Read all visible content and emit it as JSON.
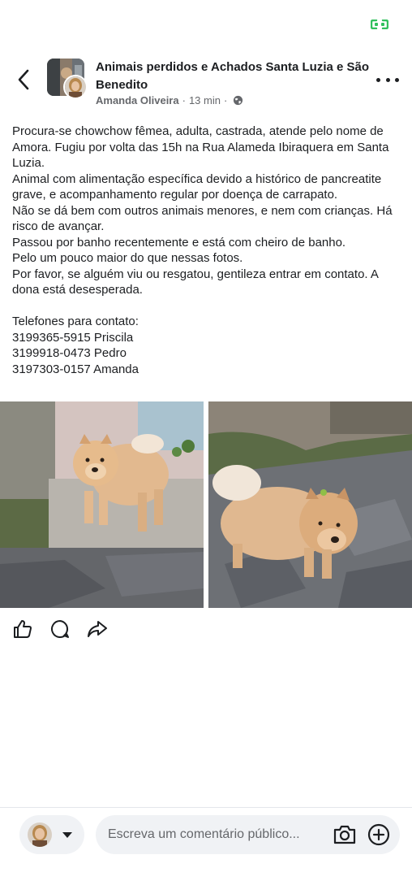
{
  "header": {
    "group_name": "Animais perdidos e Achados Santa Luzia e São Benedito",
    "author": "Amanda Oliveira",
    "separator": "·",
    "time": "13 min",
    "privacy_icon": "globe-icon"
  },
  "post": {
    "paragraphs": [
      "Procura-se chowchow fêmea, adulta, castrada, atende pelo nome de Amora. Fugiu por volta das 15h na Rua Alameda Ibiraquera em Santa Luzia.",
      "Animal com alimentação específica devido a histórico de pancreatite grave, e acompanhamento regular por doença de carrapato.",
      "Não se dá bem com outros animais menores, e nem com crianças. Há risco de avançar.",
      "Passou por banho recentemente e está com cheiro de banho.",
      "Pelo um pouco maior do que nessas fotos.",
      "Por favor, se alguém viu ou resgatou, gentileza entrar em contato. A dona está desesperada."
    ],
    "contacts_title": "Telefones para contato:",
    "contacts": [
      "3199365-5915 Priscila",
      "3199918-0473 Pedro",
      "3197303-0157 Amanda"
    ]
  },
  "actions": {
    "like_icon": "thumbs-up-icon",
    "comment_icon": "comment-icon",
    "share_icon": "share-icon"
  },
  "comment_bar": {
    "placeholder": "Escreva um comentário público..."
  },
  "colors": {
    "text": "#1c1e21",
    "secondary_text": "#65676b",
    "input_bg": "#f0f2f5",
    "status_green": "#31c05d"
  }
}
